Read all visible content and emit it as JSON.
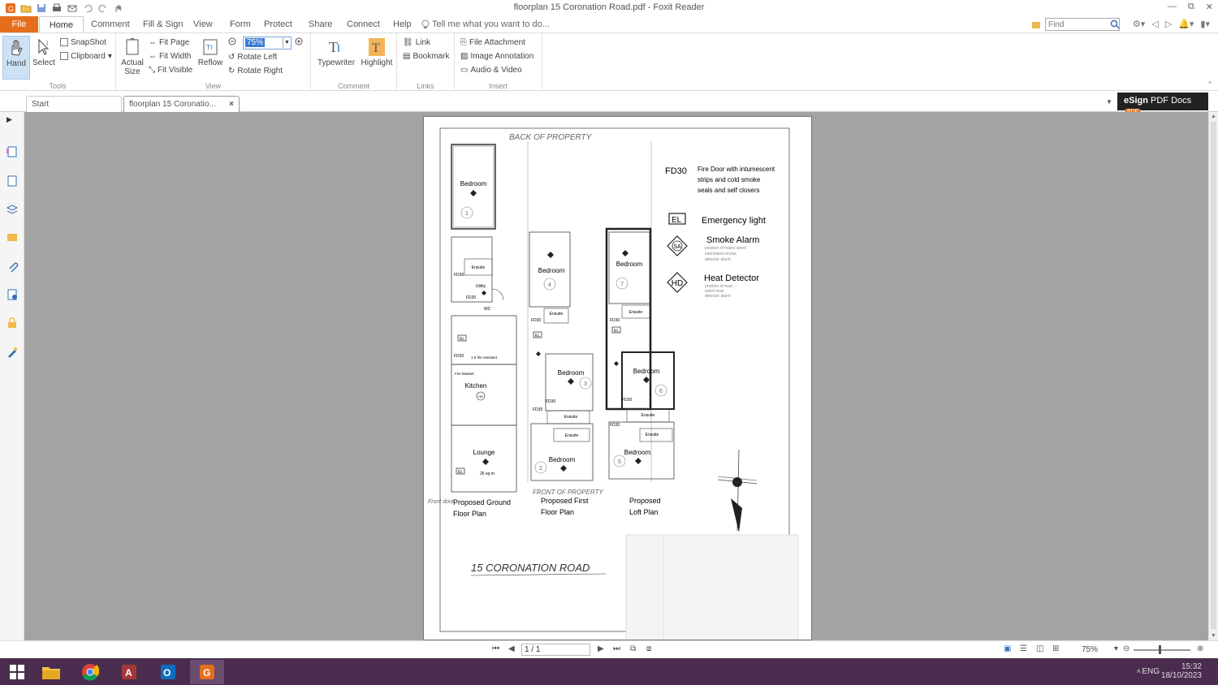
{
  "window": {
    "title": "floorplan 15 Coronation Road.pdf - Foxit Reader",
    "minimize": "—",
    "maximize": "⧉",
    "close": "✕"
  },
  "ribbon_tabs": [
    "File",
    "Home",
    "Comment",
    "Fill & Sign",
    "View",
    "Form",
    "Protect",
    "Share",
    "Connect",
    "Help"
  ],
  "tell_me": "Tell me what you want to do...",
  "find": {
    "placeholder": "Find"
  },
  "ribbon": {
    "tools": {
      "label": "Tools",
      "hand": "Hand",
      "select": "Select",
      "snapshot": "SnapShot",
      "clipboard": "Clipboard"
    },
    "view": {
      "label": "View",
      "actual_size": "Actual Size",
      "fit_page": "Fit Page",
      "fit_width": "Fit Width",
      "fit_visible": "Fit Visible",
      "reflow": "Reflow",
      "zoom_value": "75%",
      "rotate_left": "Rotate Left",
      "rotate_right": "Rotate Right"
    },
    "comment": {
      "label": "Comment",
      "typewriter": "Typewriter",
      "highlight": "Highlight"
    },
    "links": {
      "label": "Links",
      "link": "Link",
      "bookmark": "Bookmark"
    },
    "insert": {
      "label": "Insert",
      "file_attachment": "File Attachment",
      "image_annotation": "Image Annotation",
      "audio_video": "Audio & Video"
    }
  },
  "doc_tabs": [
    {
      "label": "Start"
    },
    {
      "label": "floorplan 15 Coronatio...",
      "close": "×"
    }
  ],
  "esign": {
    "brand": "eSign",
    "text": "PDF Docs",
    "badge": "PDF"
  },
  "plan": {
    "back_label": "BACK OF PROPERTY",
    "front_label": "FRONT OF PROPERTY",
    "front_door": "Front door",
    "address": "15 CORONATION ROAD",
    "legend": {
      "fd30_code": "FD30",
      "fd30_desc_1": "Fire Door with intumescent",
      "fd30_desc_2": "strips and cold smoke",
      "fd30_desc_3": "seals and self closers",
      "el_code": "EL",
      "el_desc": "Emergency light",
      "sa_code": "SA",
      "sa_desc": "Smoke Alarm",
      "sa_sub_1": "position of mains wired",
      "sa_sub_2": "interlinked smoke",
      "sa_sub_3": "detector alarm",
      "hd_code": "HD",
      "hd_desc": "Heat Detector",
      "hd_sub_1": "position of main",
      "hd_sub_2": "wired heat",
      "hd_sub_3": "detector alarm"
    },
    "ground": {
      "caption_1": "Proposed Ground",
      "caption_2": "Floor Plan",
      "bedroom": "Bedroom",
      "ensuite": "Ensuite",
      "utility": "Utility",
      "wc": "WC",
      "fd30": "FD30",
      "el": "EL",
      "partition": "1.5 fire resistant",
      "fire_blanket": "Fire blanket",
      "kitchen": "Kitchen",
      "hd": "HD",
      "lounge": "Lounge",
      "lounge_area": "26 sq m",
      "room_no": "1"
    },
    "first": {
      "caption_1": "Proposed First",
      "caption_2": "Floor Plan",
      "bedroom_a": "Bedroom",
      "bedroom_a_no": "4",
      "ensuite_a": "Ensuite",
      "fd30": "FD30",
      "el": "EL",
      "bedroom_b": "Bedroom",
      "bedroom_b_no": "3",
      "ensuite_b": "Ensuite",
      "ensuite_c": "Ensuite",
      "bedroom_c": "Bedroom",
      "bedroom_c_no": "2"
    },
    "loft": {
      "caption_1": "Proposed",
      "caption_2": "Loft Plan",
      "bedroom_a": "Bedroom",
      "bedroom_a_no": "7",
      "ensuite_a": "Ensuite",
      "fd30": "FD30",
      "el": "EL",
      "bedroom_b": "Bedroom",
      "bedroom_b_no": "6",
      "ensuite_b": "Ensuite",
      "ensuite_c": "Ensuite",
      "bedroom_c": "Bedroom",
      "bedroom_c_no": "5"
    }
  },
  "status": {
    "page_indicator": "1 / 1",
    "zoom": "75%"
  },
  "taskbar": {
    "time": "15:32",
    "date": "18/10/2023",
    "lang": "ENG"
  },
  "colors": {
    "file_tab": "#e56e1d",
    "taskbar": "#4a2d4e",
    "workspace": "#a3a3a3",
    "selection": "#3a7bd5"
  }
}
